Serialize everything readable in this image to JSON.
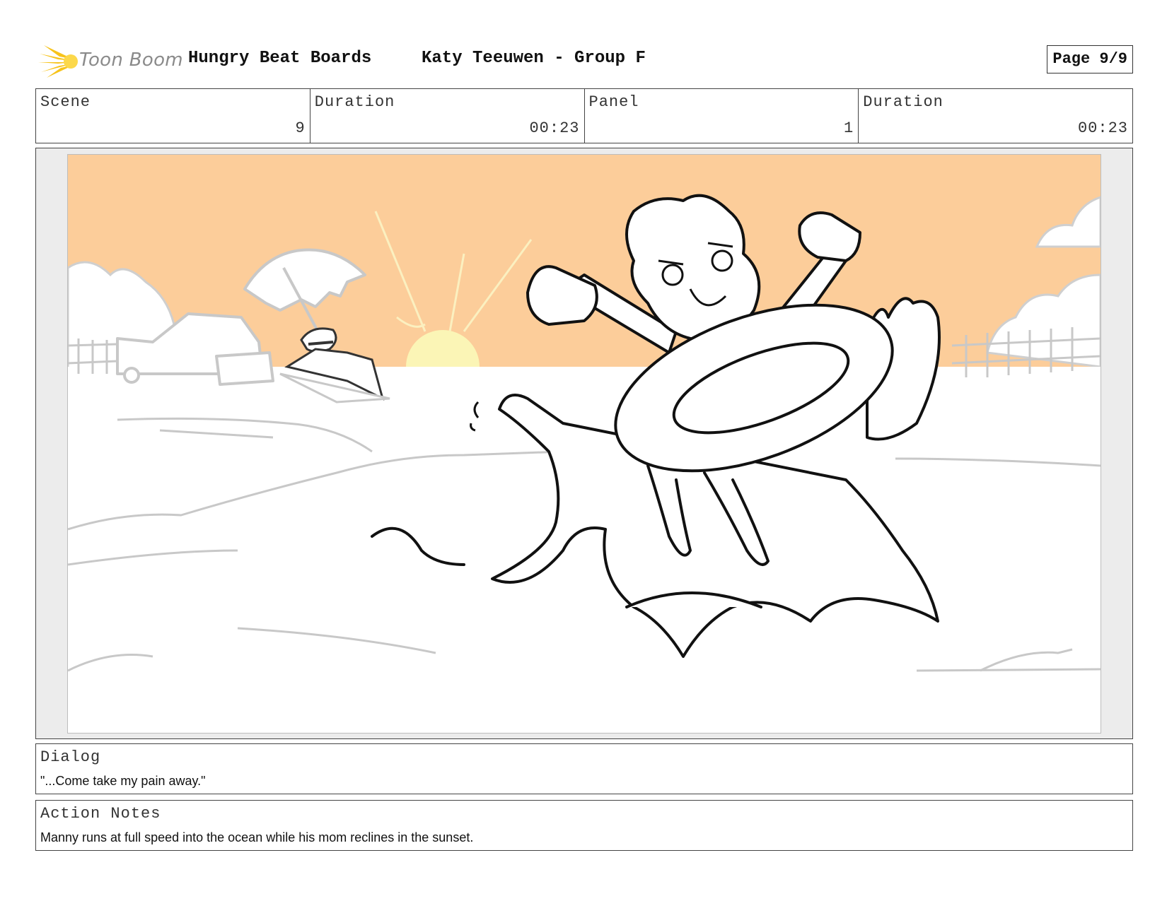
{
  "header": {
    "logo_text": "Toon Boom",
    "project_title": "Hungry Beat Boards",
    "author": "Katy Teeuwen - Group F",
    "page_label": "Page 9/9"
  },
  "info": {
    "scene_label": "Scene",
    "scene_value": "9",
    "scene_duration_label": "Duration",
    "scene_duration_value": "00:23",
    "panel_label": "Panel",
    "panel_value": "1",
    "panel_duration_label": "Duration",
    "panel_duration_value": "00:23"
  },
  "dialog": {
    "label": "Dialog",
    "text": "\"...Come take my pain away.\""
  },
  "action_notes": {
    "label": "Action Notes",
    "text": "Manny runs at full speed into the ocean while his mom reclines in the sunset."
  },
  "colors": {
    "sky": "#fccd9a",
    "sun": "#fbf5b6",
    "logo_accent": "#f7c31a",
    "border": "#444444"
  }
}
